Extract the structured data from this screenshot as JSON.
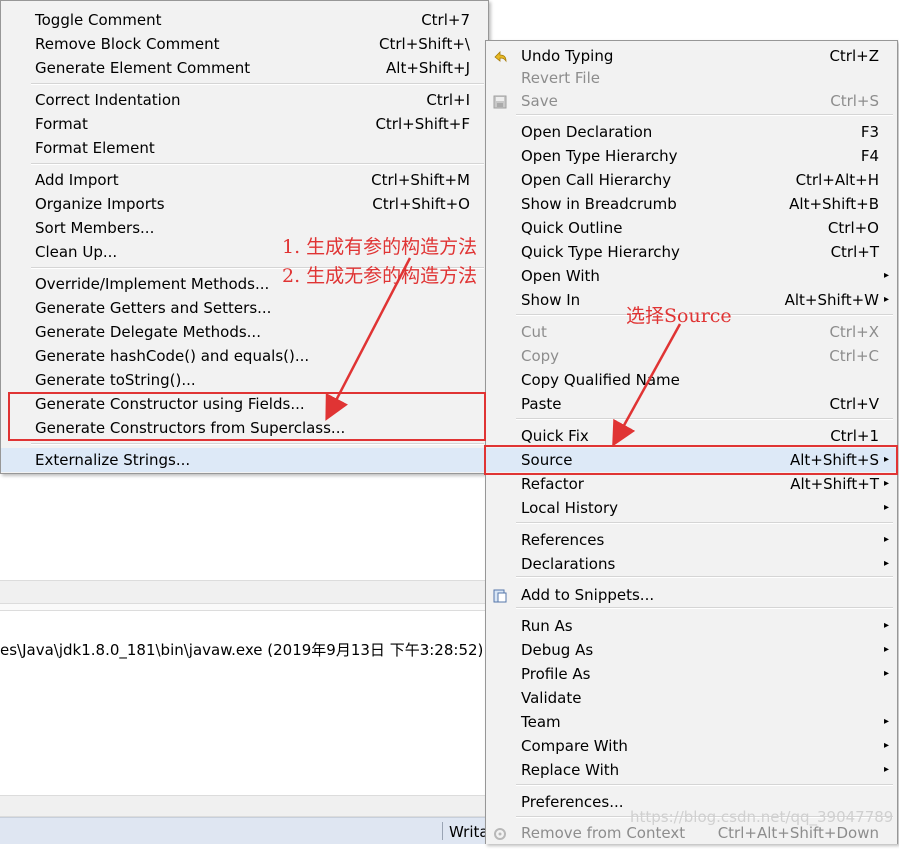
{
  "left_menu": {
    "items": [
      {
        "label": "Toggle Comment",
        "accel": "Ctrl+7"
      },
      {
        "label": "Remove Block Comment",
        "accel": "Ctrl+Shift+\\"
      },
      {
        "label": "Generate Element Comment",
        "accel": "Alt+Shift+J"
      },
      {
        "label": "Correct Indentation",
        "accel": "Ctrl+I"
      },
      {
        "label": "Format",
        "accel": "Ctrl+Shift+F"
      },
      {
        "label": "Format Element",
        "accel": ""
      },
      {
        "label": "Add Import",
        "accel": "Ctrl+Shift+M"
      },
      {
        "label": "Organize Imports",
        "accel": "Ctrl+Shift+O"
      },
      {
        "label": "Sort Members...",
        "accel": ""
      },
      {
        "label": "Clean Up...",
        "accel": ""
      },
      {
        "label": "Override/Implement Methods...",
        "accel": ""
      },
      {
        "label": "Generate Getters and Setters...",
        "accel": ""
      },
      {
        "label": "Generate Delegate Methods...",
        "accel": ""
      },
      {
        "label": "Generate hashCode() and equals()...",
        "accel": ""
      },
      {
        "label": "Generate toString()...",
        "accel": ""
      },
      {
        "label": "Generate Constructor using Fields...",
        "accel": ""
      },
      {
        "label": "Generate Constructors from Superclass...",
        "accel": ""
      },
      {
        "label": "Externalize Strings...",
        "accel": ""
      }
    ]
  },
  "right_menu": {
    "items": [
      {
        "label": "Undo Typing",
        "accel": "Ctrl+Z",
        "icon": "undo-icon"
      },
      {
        "label": "Revert File",
        "accel": "",
        "disabled": true
      },
      {
        "label": "Save",
        "accel": "Ctrl+S",
        "disabled": true,
        "icon": "save-icon"
      },
      {
        "label": "Open Declaration",
        "accel": "F3"
      },
      {
        "label": "Open Type Hierarchy",
        "accel": "F4"
      },
      {
        "label": "Open Call Hierarchy",
        "accel": "Ctrl+Alt+H"
      },
      {
        "label": "Show in Breadcrumb",
        "accel": "Alt+Shift+B"
      },
      {
        "label": "Quick Outline",
        "accel": "Ctrl+O"
      },
      {
        "label": "Quick Type Hierarchy",
        "accel": "Ctrl+T"
      },
      {
        "label": "Open With",
        "accel": "",
        "submenu": true
      },
      {
        "label": "Show In",
        "accel": "Alt+Shift+W",
        "submenu": true
      },
      {
        "label": "Cut",
        "accel": "Ctrl+X",
        "disabled": true
      },
      {
        "label": "Copy",
        "accel": "Ctrl+C",
        "disabled": true
      },
      {
        "label": "Copy Qualified Name",
        "accel": ""
      },
      {
        "label": "Paste",
        "accel": "Ctrl+V"
      },
      {
        "label": "Quick Fix",
        "accel": "Ctrl+1"
      },
      {
        "label": "Source",
        "accel": "Alt+Shift+S",
        "submenu": true,
        "highlighted": true
      },
      {
        "label": "Refactor",
        "accel": "Alt+Shift+T",
        "submenu": true
      },
      {
        "label": "Local History",
        "accel": "",
        "submenu": true
      },
      {
        "label": "References",
        "accel": "",
        "submenu": true
      },
      {
        "label": "Declarations",
        "accel": "",
        "submenu": true
      },
      {
        "label": "Add to Snippets...",
        "accel": "",
        "icon": "snippet-icon"
      },
      {
        "label": "Run As",
        "accel": "",
        "submenu": true
      },
      {
        "label": "Debug As",
        "accel": "",
        "submenu": true
      },
      {
        "label": "Profile As",
        "accel": "",
        "submenu": true
      },
      {
        "label": "Validate",
        "accel": ""
      },
      {
        "label": "Team",
        "accel": "",
        "submenu": true
      },
      {
        "label": "Compare With",
        "accel": "",
        "submenu": true
      },
      {
        "label": "Replace With",
        "accel": "",
        "submenu": true
      },
      {
        "label": "Preferences...",
        "accel": ""
      },
      {
        "label": "Remove from Context",
        "accel": "Ctrl+Alt+Shift+Down",
        "disabled": true,
        "icon": "context-icon"
      }
    ],
    "submenu_arrow": "▸"
  },
  "background": {
    "console_text": "es\\Java\\jdk1.8.0_181\\bin\\javaw.exe (2019年9月13日 下午3:28:52)",
    "status_text": "Writa"
  },
  "annotations": {
    "left_note_1": "1. 生成有参的构造方法",
    "left_note_2": "2. 生成无参的构造方法",
    "right_note": "选择Source",
    "color": "#e03434"
  },
  "watermark": "https://blog.csdn.net/qq_39047789"
}
